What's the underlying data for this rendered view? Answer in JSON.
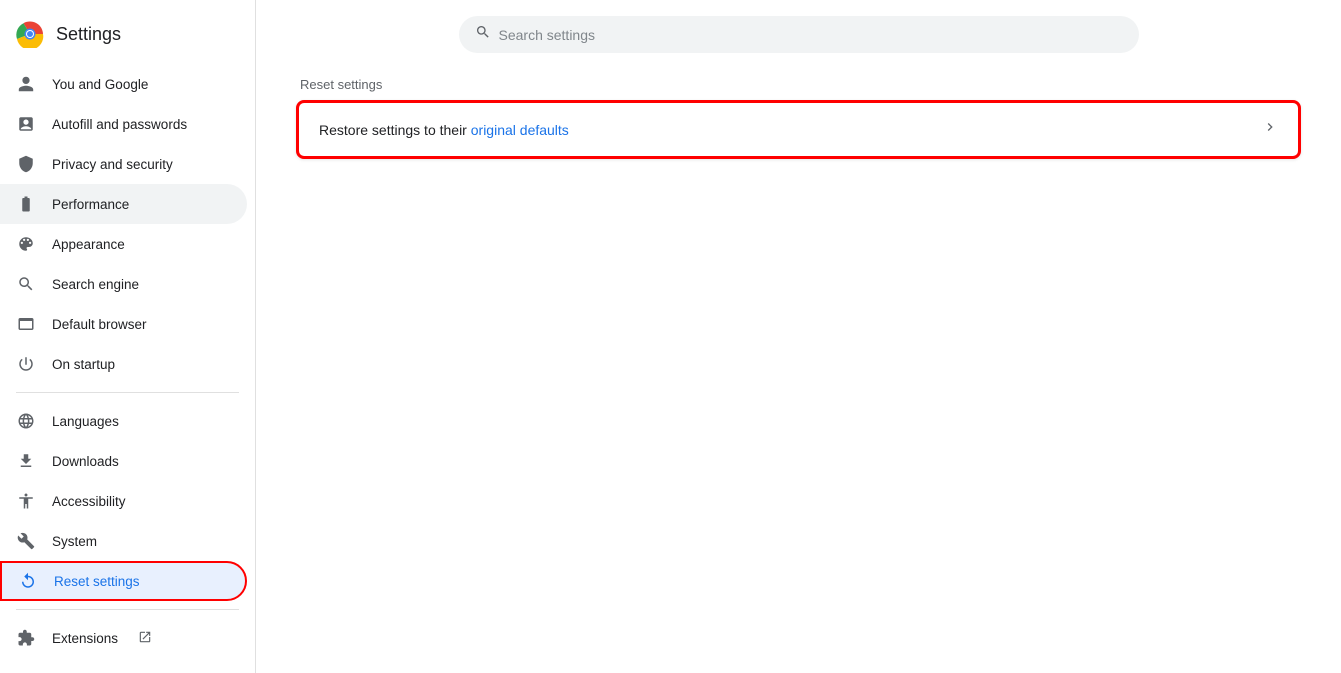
{
  "header": {
    "title": "Settings",
    "logo_alt": "Chrome logo"
  },
  "search": {
    "placeholder": "Search settings"
  },
  "sidebar": {
    "items": [
      {
        "id": "you-and-google",
        "label": "You and Google",
        "icon": "person",
        "active": false,
        "highlighted": false
      },
      {
        "id": "autofill",
        "label": "Autofill and passwords",
        "icon": "autofill",
        "active": false,
        "highlighted": false
      },
      {
        "id": "privacy",
        "label": "Privacy and security",
        "icon": "shield",
        "active": false,
        "highlighted": false
      },
      {
        "id": "performance",
        "label": "Performance",
        "icon": "speed",
        "active": false,
        "highlighted": false,
        "selected": true
      },
      {
        "id": "appearance",
        "label": "Appearance",
        "icon": "palette",
        "active": false,
        "highlighted": false
      },
      {
        "id": "search-engine",
        "label": "Search engine",
        "icon": "search",
        "active": false,
        "highlighted": false
      },
      {
        "id": "default-browser",
        "label": "Default browser",
        "icon": "browser",
        "active": false,
        "highlighted": false
      },
      {
        "id": "on-startup",
        "label": "On startup",
        "icon": "power",
        "active": false,
        "highlighted": false
      },
      {
        "id": "languages",
        "label": "Languages",
        "icon": "globe",
        "active": false,
        "highlighted": false
      },
      {
        "id": "downloads",
        "label": "Downloads",
        "icon": "download",
        "active": false,
        "highlighted": false
      },
      {
        "id": "accessibility",
        "label": "Accessibility",
        "icon": "accessibility",
        "active": false,
        "highlighted": false
      },
      {
        "id": "system",
        "label": "System",
        "icon": "wrench",
        "active": false,
        "highlighted": false
      },
      {
        "id": "reset-settings",
        "label": "Reset settings",
        "icon": "reset",
        "active": true,
        "highlighted": true
      },
      {
        "id": "extensions",
        "label": "Extensions",
        "icon": "puzzle",
        "active": false,
        "highlighted": false
      }
    ]
  },
  "main": {
    "section_title": "Reset settings",
    "rows": [
      {
        "id": "restore-defaults",
        "text_before": "Restore settings to their ",
        "text_link": "original defaults",
        "text_after": ""
      }
    ]
  }
}
